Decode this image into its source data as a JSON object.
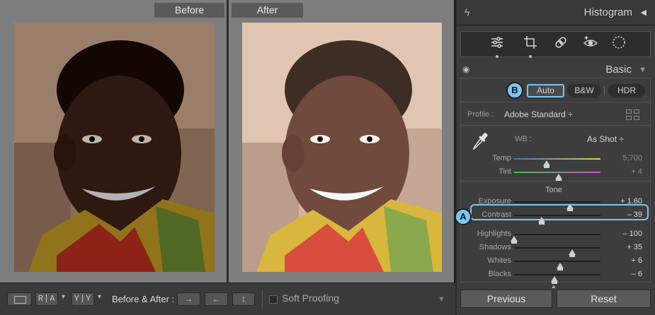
{
  "viewer": {
    "before_label": "Before",
    "after_label": "After"
  },
  "toolbar": {
    "ba_left_label": "R|A",
    "ba_split_label": "Y|Y",
    "ba_label": "Before & After :",
    "soft_proofing_label": "Soft Proofing",
    "soft_proofing_checked": false
  },
  "panel": {
    "histogram_title": "Histogram",
    "tools": [
      "adjust-sliders-icon",
      "crop-icon",
      "healing-bandage-icon",
      "red-eye-icon",
      "mask-circle-icon"
    ],
    "basic": {
      "title": "Basic",
      "auto_label": "Auto",
      "bw_label": "B&W",
      "hdr_label": "HDR",
      "profile_label": "Profile :",
      "profile_value": "Adobe Standard ÷",
      "wb_label": "WB :",
      "wb_value": "As Shot ÷",
      "temp": {
        "label": "Temp",
        "value": "5,700",
        "position": 0.38
      },
      "tint": {
        "label": "Tint",
        "value": "+ 4",
        "position": 0.52
      },
      "tone_label": "Tone",
      "exposure": {
        "label": "Exposure",
        "value": "+ 1.60",
        "position": 0.65
      },
      "contrast": {
        "label": "Contrast",
        "value": "– 39",
        "position": 0.32
      },
      "highlights": {
        "label": "Highlights",
        "value": "– 100",
        "position": 0.0
      },
      "shadows": {
        "label": "Shadows",
        "value": "+ 35",
        "position": 0.67
      },
      "whites": {
        "label": "Whites",
        "value": "+ 6",
        "position": 0.53
      },
      "blacks": {
        "label": "Blacks",
        "value": "– 6",
        "position": 0.47
      }
    },
    "previous_label": "Previous",
    "reset_label": "Reset"
  },
  "callouts": {
    "a": "A",
    "b": "B"
  },
  "colors": {
    "highlight": "#7ec4f0",
    "panel_bg": "#3c3c3c",
    "viewer_bg": "#7d7d7d"
  }
}
